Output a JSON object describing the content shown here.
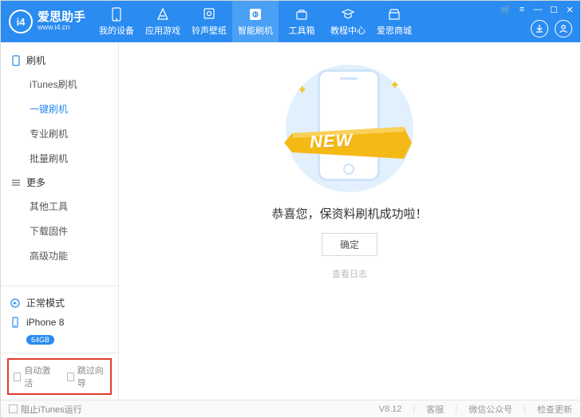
{
  "app": {
    "name": "爱思助手",
    "url": "www.i4.cn",
    "logo_text": "i4"
  },
  "nav": {
    "items": [
      {
        "label": "我的设备",
        "icon": "device"
      },
      {
        "label": "应用游戏",
        "icon": "apps"
      },
      {
        "label": "铃声壁纸",
        "icon": "ringtone"
      },
      {
        "label": "智能刷机",
        "icon": "flash",
        "active": true
      },
      {
        "label": "工具箱",
        "icon": "toolbox"
      },
      {
        "label": "教程中心",
        "icon": "tutorial"
      },
      {
        "label": "爱思商城",
        "icon": "store"
      }
    ]
  },
  "sidebar": {
    "groups": [
      {
        "title": "刷机",
        "items": [
          "iTunes刷机",
          "一键刷机",
          "专业刷机",
          "批量刷机"
        ],
        "active_item": "一键刷机"
      },
      {
        "title": "更多",
        "items": [
          "其他工具",
          "下载固件",
          "高级功能"
        ]
      }
    ],
    "mode": "正常模式",
    "device": "iPhone 8",
    "storage": "64GB"
  },
  "footer_checks": {
    "auto_activate": "自动激活",
    "skip_wizard": "跳过向导"
  },
  "main": {
    "new_label": "NEW",
    "success_text": "恭喜您，保资料刷机成功啦！",
    "ok_button": "确定",
    "view_log": "查看日志"
  },
  "statusbar": {
    "block_itunes": "阻止iTunes运行",
    "version": "V8.12",
    "support": "客服",
    "wechat": "微信公众号",
    "check_update": "检查更新"
  }
}
